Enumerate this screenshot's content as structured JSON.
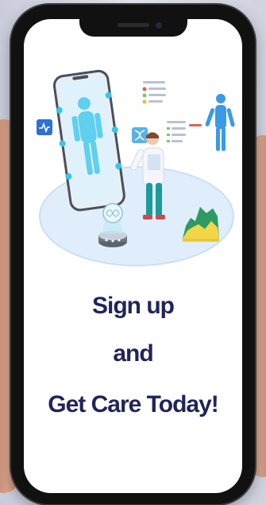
{
  "headline": {
    "line1": "Sign up",
    "line2": "and",
    "line3": "Get Care Today!"
  },
  "colors": {
    "headline": "#1f2459",
    "accent": "#35c6e8",
    "platform": "#dfeefa"
  },
  "illustration": {
    "icons": [
      "heart-rate-icon",
      "brain-hologram-icon",
      "dna-icon",
      "human-figure-icon",
      "chart-icon"
    ]
  }
}
